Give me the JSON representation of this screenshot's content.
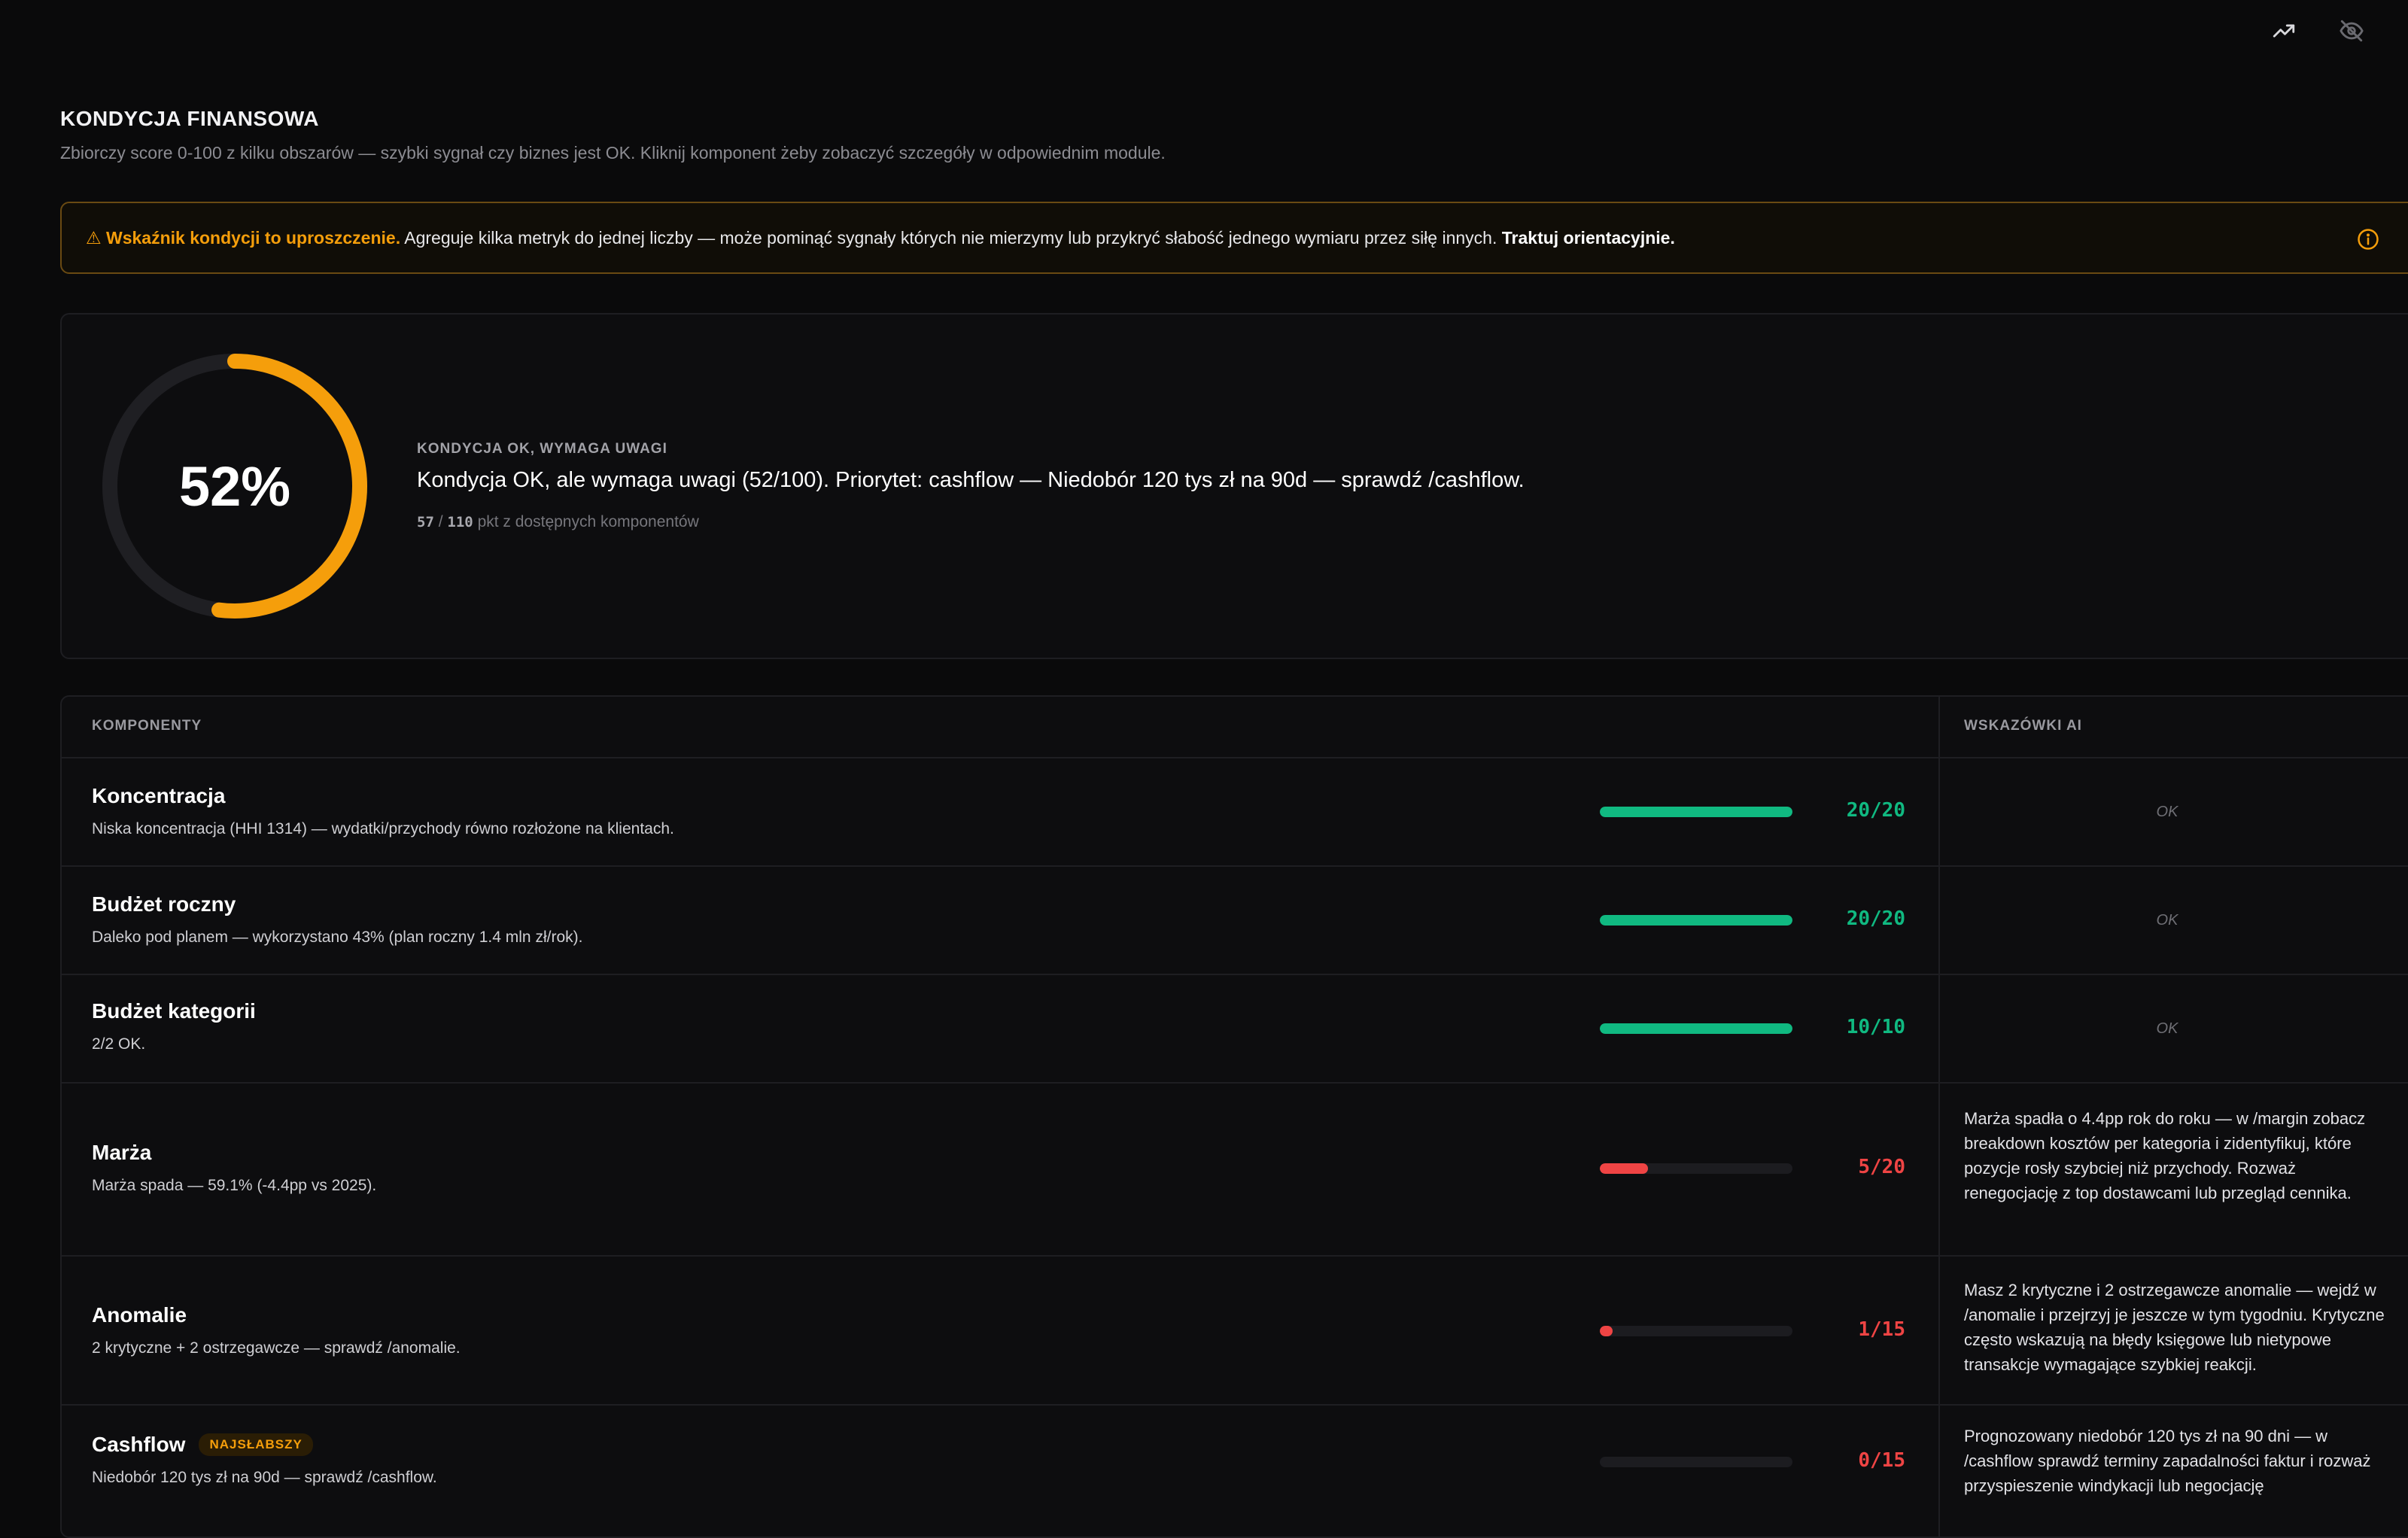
{
  "header": {
    "title": "KONDYCJA FINANSOWA",
    "subtitle": "Zbiorczy score 0-100 z kilku obszarów — szybki sygnał czy biznes jest OK. Kliknij komponent żeby zobaczyć szczegóły w odpowiednim module."
  },
  "top_icons": [
    "trending-up-icon",
    "eye-off-icon"
  ],
  "warning": {
    "lead": "⚠ Wskaźnik kondycji to uproszczenie.",
    "body": " Agreguje kilka metryk do jednej liczby — może pominąć sygnały których nie mierzymy lub przykryć słabość jednego wymiaru przez siłę innych. ",
    "tail": "Traktuj orientacyjnie."
  },
  "score": {
    "percent": 52,
    "percent_label": "52%",
    "kicker": "KONDYCJA OK, WYMAGA UWAGI",
    "headline": "Kondycja OK, ale wymaga uwagi (52/100). Priorytet: cashflow — Niedobór 120 tys zł na 90d — sprawdź /cashflow.",
    "points": "57",
    "sep": " / ",
    "max": "110",
    "points_suffix": " pkt z dostępnych komponentów",
    "ring_color": "#f59e0b"
  },
  "table": {
    "header_components": "KOMPONENTY",
    "header_tips": "WSKAZÓWKI AI",
    "rows": [
      {
        "name": "Koncentracja",
        "desc": "Niska koncentracja (HHI 1314) — wydatki/przychody równo rozłożone na klientach.",
        "score": "20/20",
        "fraction": 1.0,
        "status": "good",
        "tip": "OK"
      },
      {
        "name": "Budżet roczny",
        "desc": "Daleko pod planem — wykorzystano 43% (plan roczny 1.4 mln zł/rok).",
        "score": "20/20",
        "fraction": 1.0,
        "status": "good",
        "tip": "OK"
      },
      {
        "name": "Budżet kategorii",
        "desc": "2/2 OK.",
        "score": "10/10",
        "fraction": 1.0,
        "status": "good",
        "tip": "OK"
      },
      {
        "name": "Marża",
        "desc": "Marża spada — 59.1% (-4.4pp vs 2025).",
        "score": "5/20",
        "fraction": 0.25,
        "status": "bad",
        "tip": "Marża spadła o 4.4pp rok do roku — w /margin zobacz breakdown kosztów per kategoria i zidentyfikuj, które pozycje rosły szybciej niż przychody. Rozważ renegocjację z top dostawcami lub przegląd cennika."
      },
      {
        "name": "Anomalie",
        "desc": "2 krytyczne + 2 ostrzegawcze — sprawdź /anomalie.",
        "score": "1/15",
        "fraction": 0.0667,
        "status": "bad",
        "tip": "Masz 2 krytyczne i 2 ostrzegawcze anomalie — wejdź w /anomalie i przejrzyj je jeszcze w tym tygodniu. Krytyczne często wskazują na błędy księgowe lub nietypowe transakcje wymagające szybkiej reakcji."
      },
      {
        "name": "Cashflow",
        "badge": "NAJSŁABSZY",
        "desc": "Niedobór 120 tys zł na 90d — sprawdź /cashflow.",
        "score": "0/15",
        "fraction": 0.0,
        "status": "bad",
        "tip": "Prognozowany niedobór 120 tys zł na 90 dni — w /cashflow sprawdź terminy zapadalności faktur i rozważ przyspieszenie windykacji lub negocjację"
      }
    ]
  },
  "colors": {
    "good": "#10b981",
    "bad": "#ef4444",
    "accent": "#f59e0b",
    "track": "#222226"
  }
}
